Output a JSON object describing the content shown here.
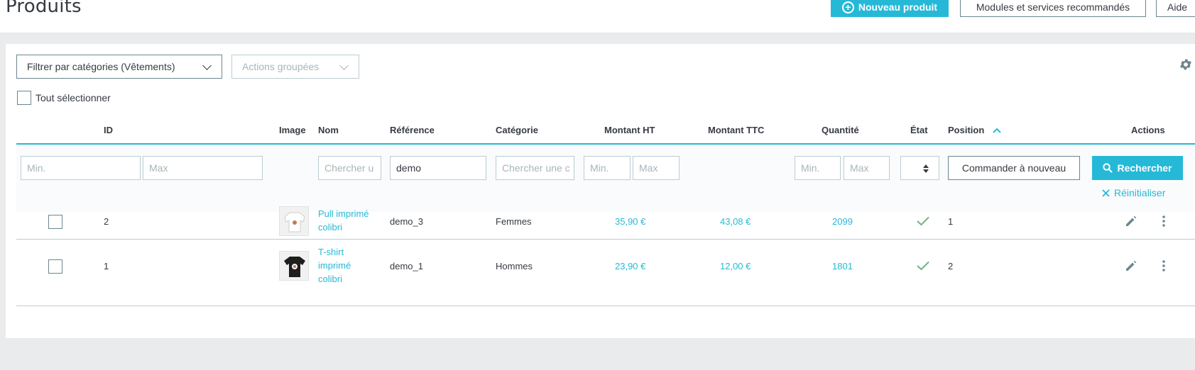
{
  "header": {
    "title": "Produits",
    "new_product_label": "Nouveau produit",
    "modules_label": "Modules et services recommandés",
    "help_label": "Aide"
  },
  "toolbar": {
    "category_filter_label": "Filtrer par catégories (Vêtements)",
    "bulk_actions_label": "Actions groupées",
    "select_all_label": "Tout sélectionner"
  },
  "columns": {
    "id": "ID",
    "image": "Image",
    "name": "Nom",
    "reference": "Référence",
    "category": "Catégorie",
    "price_ht": "Montant HT",
    "price_ttc": "Montant TTC",
    "quantity": "Quantité",
    "state": "État",
    "position": "Position",
    "actions": "Actions"
  },
  "filters": {
    "id_min_placeholder": "Min.",
    "id_max_placeholder": "Max",
    "name_placeholder": "Chercher u",
    "reference_value": "demo",
    "category_placeholder": "Chercher une c",
    "price_min_placeholder": "Min.",
    "price_max_placeholder": "Max",
    "qty_min_placeholder": "Min.",
    "qty_max_placeholder": "Max",
    "reorder_label": "Commander à nouveau",
    "search_label": "Rechercher",
    "reset_label": "Réinitialiser"
  },
  "rows": [
    {
      "id": "2",
      "name_line1": "Pull imprimé",
      "name_line2": "colibri",
      "name_line3": "",
      "reference": "demo_3",
      "category": "Femmes",
      "price_ht": "35,90 €",
      "price_ttc": "43,08 €",
      "quantity": "2099",
      "position": "1"
    },
    {
      "id": "1",
      "name_line1": "T-shirt",
      "name_line2": "imprimé",
      "name_line3": "colibri",
      "reference": "demo_1",
      "category": "Hommes",
      "price_ht": "23,90 €",
      "price_ttc": "12,00 €",
      "quantity": "1801",
      "position": "2"
    }
  ],
  "colors": {
    "accent": "#25b9d7",
    "success": "#70b580",
    "text": "#363a41",
    "border": "#bbcdd2"
  }
}
